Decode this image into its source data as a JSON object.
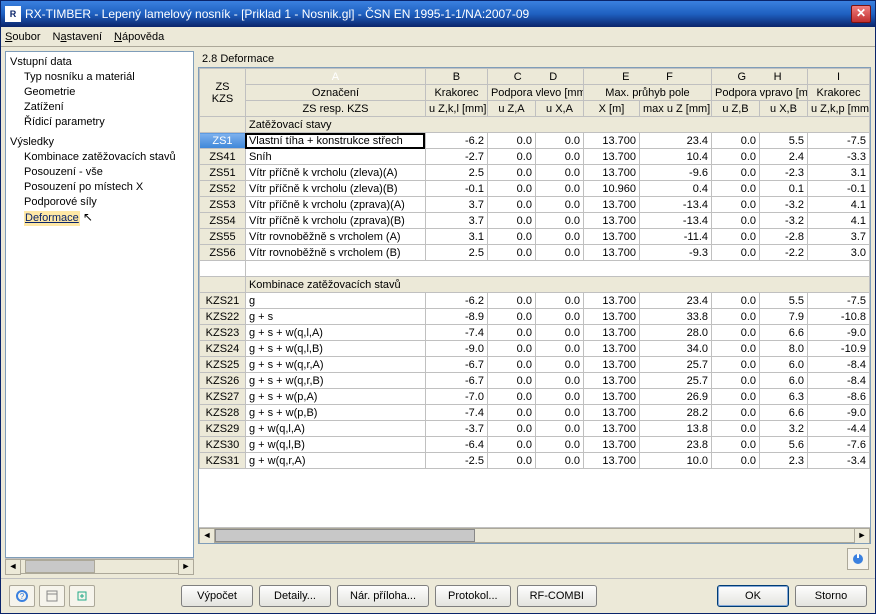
{
  "window": {
    "title": "RX-TIMBER - Lepený lamelový nosník - [Priklad 1 - Nosnik.gl] - ČSN EN 1995-1-1/NA:2007-09"
  },
  "menu": {
    "items": [
      "Soubor",
      "Nastavení",
      "Nápověda"
    ]
  },
  "tree": {
    "roots": [
      {
        "label": "Vstupní data",
        "children": [
          "Typ nosníku a materiál",
          "Geometrie",
          "Zatížení",
          "Řídicí parametry"
        ]
      },
      {
        "label": "Výsledky",
        "children": [
          "Kombinace zatěžovacích stavů",
          "Posouzení - vše",
          "Posouzení po místech X",
          "Podporové síly",
          "Deformace"
        ]
      }
    ],
    "selected": "Deformace"
  },
  "panel": {
    "title": "2.8 Deformace"
  },
  "grid": {
    "rowHeadTop": "ZS",
    "rowHeadBottom": "KZS",
    "colLetters": [
      "A",
      "B",
      "C",
      "D",
      "E",
      "F",
      "G",
      "H",
      "I"
    ],
    "colHeadRow1": [
      "Označení",
      "Krakorec",
      "Podpora vlevo [mm]",
      "",
      "Max. průhyb pole",
      "",
      "Podpora vpravo [mm]",
      "",
      "Krakorec"
    ],
    "colHeadRow2": [
      "ZS resp. KZS",
      "u Z,k,l [mm]",
      "u Z,A",
      "u X,A",
      "X [m]",
      "max u Z [mm]",
      "u Z,B",
      "u X,B",
      "u Z,k,p [mm]"
    ],
    "section1": "Zatěžovací stavy",
    "section2": "Kombinace zatěžovacích stavů",
    "loadCases": [
      {
        "id": "ZS1",
        "name": "Vlastní tíha + konstrukce střech",
        "v": [
          "-6.2",
          "0.0",
          "0.0",
          "13.700",
          "23.4",
          "0.0",
          "5.5",
          "-7.5"
        ]
      },
      {
        "id": "ZS41",
        "name": "Sníh",
        "v": [
          "-2.7",
          "0.0",
          "0.0",
          "13.700",
          "10.4",
          "0.0",
          "2.4",
          "-3.3"
        ]
      },
      {
        "id": "ZS51",
        "name": "Vítr příčně k vrcholu (zleva)(A)",
        "v": [
          "2.5",
          "0.0",
          "0.0",
          "13.700",
          "-9.6",
          "0.0",
          "-2.3",
          "3.1"
        ]
      },
      {
        "id": "ZS52",
        "name": "Vítr příčně k vrcholu (zleva)(B)",
        "v": [
          "-0.1",
          "0.0",
          "0.0",
          "10.960",
          "0.4",
          "0.0",
          "0.1",
          "-0.1"
        ]
      },
      {
        "id": "ZS53",
        "name": "Vítr příčně k vrcholu (zprava)(A)",
        "v": [
          "3.7",
          "0.0",
          "0.0",
          "13.700",
          "-13.4",
          "0.0",
          "-3.2",
          "4.1"
        ]
      },
      {
        "id": "ZS54",
        "name": "Vítr příčně k vrcholu (zprava)(B)",
        "v": [
          "3.7",
          "0.0",
          "0.0",
          "13.700",
          "-13.4",
          "0.0",
          "-3.2",
          "4.1"
        ]
      },
      {
        "id": "ZS55",
        "name": "Vítr rovnoběžně s vrcholem (A)",
        "v": [
          "3.1",
          "0.0",
          "0.0",
          "13.700",
          "-11.4",
          "0.0",
          "-2.8",
          "3.7"
        ]
      },
      {
        "id": "ZS56",
        "name": "Vítr rovnoběžně s vrcholem (B)",
        "v": [
          "2.5",
          "0.0",
          "0.0",
          "13.700",
          "-9.3",
          "0.0",
          "-2.2",
          "3.0"
        ]
      }
    ],
    "combos": [
      {
        "id": "KZS21",
        "name": "g",
        "v": [
          "-6.2",
          "0.0",
          "0.0",
          "13.700",
          "23.4",
          "0.0",
          "5.5",
          "-7.5"
        ]
      },
      {
        "id": "KZS22",
        "name": "g + s",
        "v": [
          "-8.9",
          "0.0",
          "0.0",
          "13.700",
          "33.8",
          "0.0",
          "7.9",
          "-10.8"
        ]
      },
      {
        "id": "KZS23",
        "name": "g + s + w(q,l,A)",
        "v": [
          "-7.4",
          "0.0",
          "0.0",
          "13.700",
          "28.0",
          "0.0",
          "6.6",
          "-9.0"
        ]
      },
      {
        "id": "KZS24",
        "name": "g + s + w(q,l,B)",
        "v": [
          "-9.0",
          "0.0",
          "0.0",
          "13.700",
          "34.0",
          "0.0",
          "8.0",
          "-10.9"
        ]
      },
      {
        "id": "KZS25",
        "name": "g + s + w(q,r,A)",
        "v": [
          "-6.7",
          "0.0",
          "0.0",
          "13.700",
          "25.7",
          "0.0",
          "6.0",
          "-8.4"
        ]
      },
      {
        "id": "KZS26",
        "name": "g + s + w(q,r,B)",
        "v": [
          "-6.7",
          "0.0",
          "0.0",
          "13.700",
          "25.7",
          "0.0",
          "6.0",
          "-8.4"
        ]
      },
      {
        "id": "KZS27",
        "name": "g + s + w(p,A)",
        "v": [
          "-7.0",
          "0.0",
          "0.0",
          "13.700",
          "26.9",
          "0.0",
          "6.3",
          "-8.6"
        ]
      },
      {
        "id": "KZS28",
        "name": "g + s + w(p,B)",
        "v": [
          "-7.4",
          "0.0",
          "0.0",
          "13.700",
          "28.2",
          "0.0",
          "6.6",
          "-9.0"
        ]
      },
      {
        "id": "KZS29",
        "name": "g + w(q,l,A)",
        "v": [
          "-3.7",
          "0.0",
          "0.0",
          "13.700",
          "13.8",
          "0.0",
          "3.2",
          "-4.4"
        ]
      },
      {
        "id": "KZS30",
        "name": "g + w(q,l,B)",
        "v": [
          "-6.4",
          "0.0",
          "0.0",
          "13.700",
          "23.8",
          "0.0",
          "5.6",
          "-7.6"
        ]
      },
      {
        "id": "KZS31",
        "name": "g + w(q,r,A)",
        "v": [
          "-2.5",
          "0.0",
          "0.0",
          "13.700",
          "10.0",
          "0.0",
          "2.3",
          "-3.4"
        ]
      }
    ]
  },
  "buttons": {
    "vypocet": "Výpočet",
    "detaily": "Detaily...",
    "narpriloha": "Nár. příloha...",
    "protokol": "Protokol...",
    "rfcombi": "RF-COMBI",
    "ok": "OK",
    "storno": "Storno"
  }
}
